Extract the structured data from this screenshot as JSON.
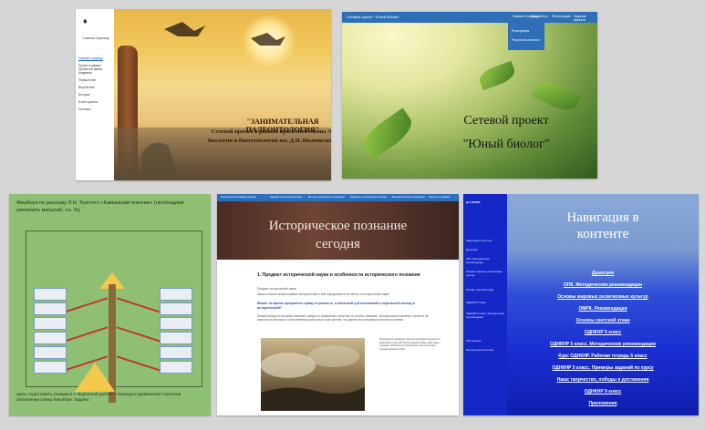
{
  "tile_paleontology": {
    "logo": "♦",
    "header_text": "Главная страница",
    "nav_items": [
      "Главная страница",
      "Проект в рамках Проектной смены Академии",
      "Первый этап",
      "Второй этап",
      "История",
      "Итоги проекта",
      "Контакты"
    ],
    "title": "\"ЗАНИМАТЕЛЬНАЯ ПАЛЕОНТОЛОГИЯ\"",
    "description": "Сетевой проект в рамках проектной смены Академии биологии и биотехнологии им. Д.И. Ивановского (ЮФУ)"
  },
  "tile_network": {
    "brand": "Сетевой проект \"Юный биолог\"",
    "menu_items": [
      "Главная страница",
      "Документы",
      "Регистрация",
      "Задание проекта"
    ],
    "dropdown_items": [
      "Регистрация",
      "Результаты проекта"
    ],
    "title_line1": "Сетевой проект",
    "title_line2": "\"Юный биолог\""
  },
  "tile_fishbone": {
    "caption": "Фишбоун по рассказу Л.Н. Толстого «Кавказский пленник» (необходимо увеличить масштаб, т.е. %)",
    "footer": "Цель: подготовить учащихся к творческой работе с помощью применения стратегии заполнения схемы Фишбоун. Задачи:"
  },
  "tile_history": {
    "tabs": [
      "Историческое познание сегодня",
      "Предмет исторической науки",
      "Методы исторического познания",
      "Научность исторического знания",
      "Методологические проблемы",
      "Понятия и термины"
    ],
    "banner_line1": "Историческое познание",
    "banner_line2": "сегодня",
    "heading": "1. Предмет исторической науки и особенности исторического познания",
    "line1": "Предмет исторической науки",
    "line2": "Какое событие можно назвать историческим и кем определяется его место в исторической науке",
    "question": "Может ли время превратить кражу в ценность, а обычный субъективный и отдельный взгляд в исторический?",
    "paragraph": "Новый взгляд на историю позволяет увидеть в привычных событиях их особое значение. Историческое познание строится на анализе источников и сопоставлении различных точек зрения, что делает его результаты многосторонними.",
    "painting_caption": "Бородинское сражение. Картина посвящена одному из важнейших событий Отечественной войны 1812 года и отражает особенности восприятия прошлого через художественный образ."
  },
  "tile_navigation": {
    "side_title": "Д.О.ОЕРКИ",
    "side_items": [
      "Навигация в контенте",
      "Душегрея",
      "ОПК. Методические рекомендации",
      "Основы мировых религиозных культур",
      "Основы светской этики",
      "ОДНКНР 5 класс",
      "ОДНКНР 5 класс. Методические рекомендации",
      "Приложения",
      "Методическая копилка"
    ],
    "title_line1": "Навигация в",
    "title_line2": "контенте",
    "links": [
      "Душегрея",
      "ОПК. Методические рекомендации",
      "Основы мировых религиозных культур",
      "ОМРК. Рекомендации",
      "Основы светской этики",
      "ОДНКНР 5 класс",
      "ОДНКНР 5 класс. Методические рекомендации",
      "Курс ОДНКНР. Рабочая тетрадь 5 класс",
      "ОДНКНР 5 класс. Примеры заданий по курсу",
      "Наше творчество, победы и достижения",
      "ОДНКНР 9 класс",
      "Приложения"
    ]
  }
}
